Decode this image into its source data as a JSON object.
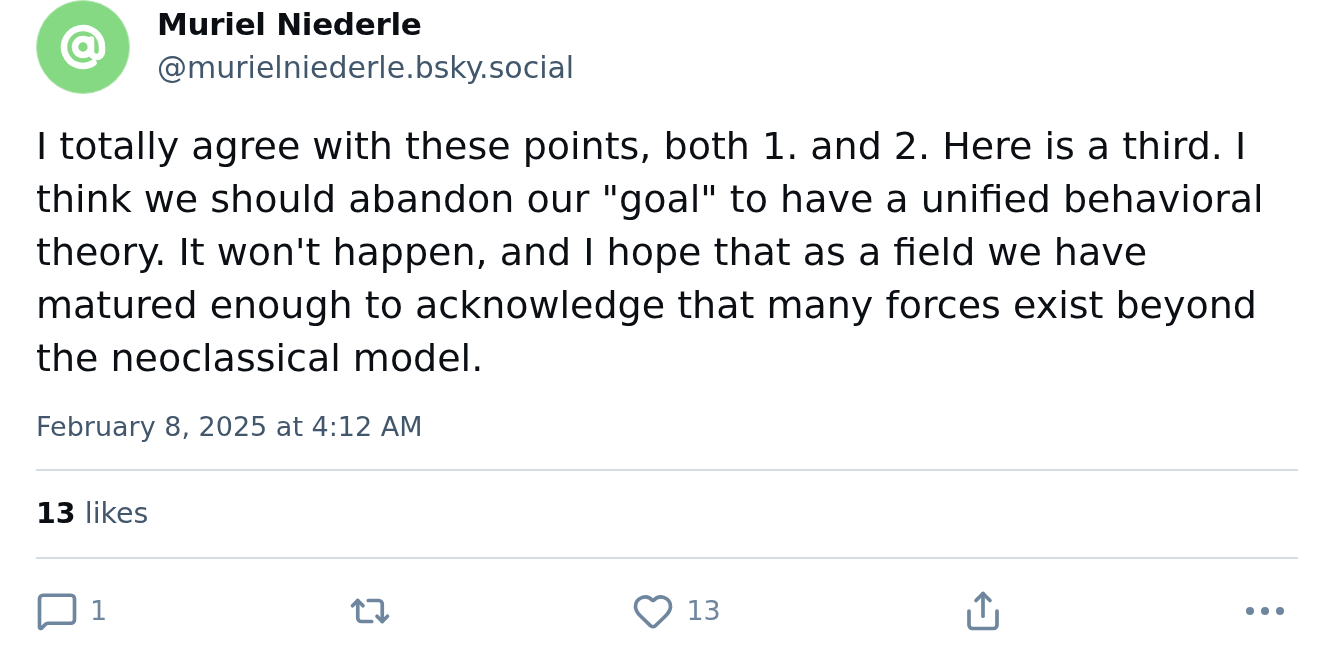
{
  "author": {
    "name": "Muriel Niederle",
    "handle": "@murielniederle.bsky.social"
  },
  "post": {
    "text": "I totally agree with these points, both 1. and 2. Here is a third. I think we should abandon our \"goal\" to have a unified behavioral theory. It won't happen, and I hope that as a field we have matured enough to acknowledge that many forces exist beyond the neoclassical model.",
    "timestamp": "February 8, 2025 at 4:12 AM"
  },
  "stats": {
    "likes_count": "13",
    "likes_label": "likes"
  },
  "actions": [
    {
      "kind": "reply",
      "count": "1"
    },
    {
      "kind": "repost"
    },
    {
      "kind": "like",
      "count": "13"
    },
    {
      "kind": "share"
    },
    {
      "kind": "more"
    }
  ]
}
